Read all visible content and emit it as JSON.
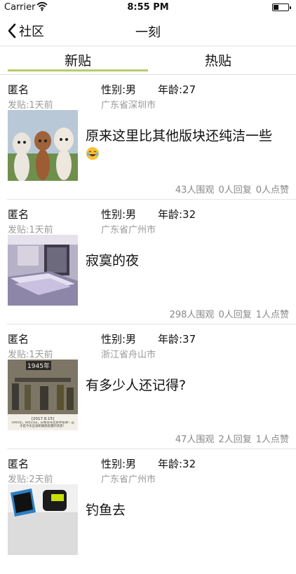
{
  "status_bar": {
    "carrier": "Carrier",
    "time": "8:55 PM"
  },
  "nav": {
    "back_label": "社区",
    "title": "一刻"
  },
  "tabs": [
    {
      "label": "新贴",
      "active": true
    },
    {
      "label": "热贴",
      "active": false
    }
  ],
  "posts": [
    {
      "author": "匿名",
      "gender": "性别:男",
      "age": "年龄:27",
      "posted": "发贴:1天前",
      "location": "广东省深圳市",
      "title": "原来这里比其他版块还纯洁一些",
      "emoji": "laughing-tears-emoji",
      "views": "43人围观",
      "replies": "0人回复",
      "likes": "0人点赞",
      "image": "alpacas-photo"
    },
    {
      "author": "匿名",
      "gender": "性别:男",
      "age": "年龄:32",
      "posted": "发贴:1天前",
      "location": "广东省广州市",
      "title": "寂寞的夜",
      "views": "298人围观",
      "replies": "0人回复",
      "likes": "1人点赞",
      "image": "bedroom-photo"
    },
    {
      "author": "匿名",
      "gender": "性别:男",
      "age": "年龄:37",
      "posted": "发贴:1天前",
      "location": "浙江省舟山市",
      "title": "有多少人还记得?",
      "views": "47人围观",
      "replies": "2人回复",
      "likes": "1人点赞",
      "image": "historical-photo",
      "image_text": {
        "year": "1945年",
        "date": "[2017.8.15]",
        "caption": "1945年，8月15日，日本宣布无条件投降！这才是今天应该刷满朋友圈的消息！"
      }
    },
    {
      "author": "匿名",
      "gender": "性别:男",
      "age": "年龄:32",
      "posted": "发贴:2天前",
      "location": "广东省广州市",
      "title": "钓鱼去",
      "image": "fishing-photo"
    }
  ],
  "colors": {
    "tab_underline": "#b8cc6a",
    "meta_gray": "#9a9a9a"
  }
}
